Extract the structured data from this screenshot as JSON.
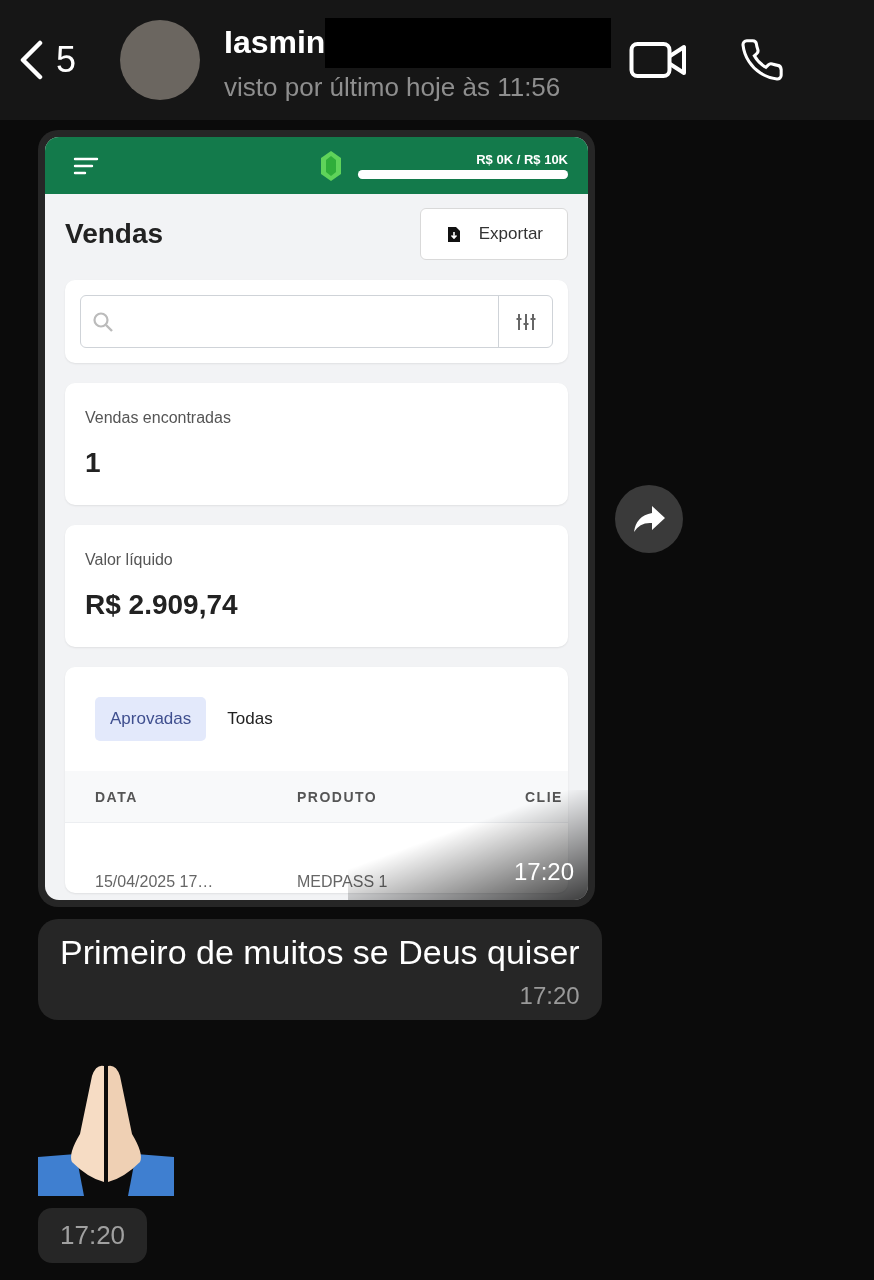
{
  "header": {
    "back_count": "5",
    "contact_name": "Iasmin",
    "status": "visto por último hoje às 11:56"
  },
  "messages": [
    {
      "kind": "image",
      "time": "17:20",
      "screenshot": {
        "goal": {
          "text": "R$ 0K / R$ 10K",
          "level": 1
        },
        "title": "Vendas",
        "export_label": "Exportar",
        "stats": [
          {
            "label": "Vendas encontradas",
            "value": "1"
          },
          {
            "label": "Valor líquido",
            "value": "R$ 2.909,74"
          }
        ],
        "tabs": [
          {
            "label": "Aprovadas",
            "selected": true
          },
          {
            "label": "Todas",
            "selected": false
          }
        ],
        "table": {
          "columns": [
            "DATA",
            "PRODUTO",
            "CLIE"
          ],
          "rows": [
            [
              "15/04/2025 17…",
              "MEDPASS 1"
            ]
          ]
        }
      }
    },
    {
      "kind": "text",
      "text": "Primeiro de muitos se Deus quiser",
      "time": "17:20"
    },
    {
      "kind": "emoji",
      "time": "17:20"
    }
  ]
}
